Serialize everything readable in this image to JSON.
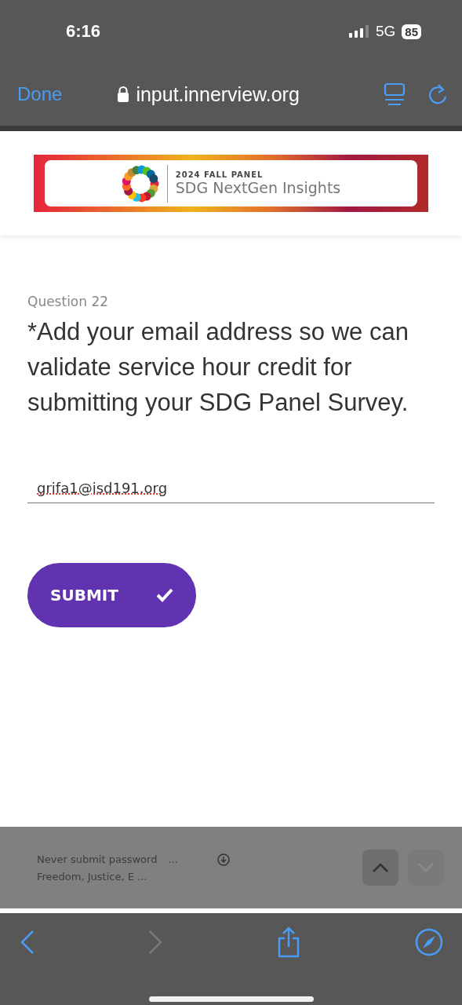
{
  "status_bar": {
    "time": "6:16",
    "network": "5G",
    "battery": "85"
  },
  "browser_bar": {
    "done": "Done",
    "url": "input.innerview.org"
  },
  "banner": {
    "eyebrow": "2024 FALL PANEL",
    "title": "SDG NextGen Insights"
  },
  "question": {
    "number": "Question 22",
    "text": "*Add your email address so we can validate service hour credit for submitting your SDG Panel Survey.",
    "value": "grifa1@isd191.org"
  },
  "submit": {
    "label": "SUBMIT"
  },
  "footer": {
    "lines": [
      {
        "text": "Never submit password",
        "extra": "..."
      },
      {
        "text": "Freedom, Justice, E ..."
      }
    ],
    "nav": [
      {
        "kind": "up",
        "disabled": false
      },
      {
        "kind": "down",
        "disabled": true
      }
    ]
  },
  "toolbar": [
    {
      "kind": "back",
      "disabled": false
    },
    {
      "kind": "forward",
      "disabled": true
    },
    {
      "kind": "share",
      "disabled": false
    },
    {
      "kind": "compass",
      "disabled": false
    }
  ]
}
